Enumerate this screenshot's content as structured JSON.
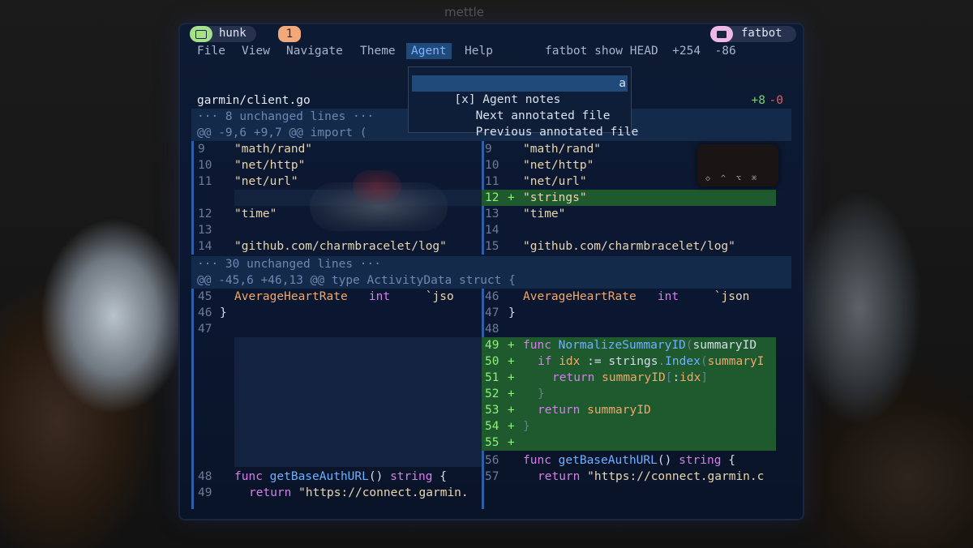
{
  "background": {
    "word": "mettle"
  },
  "tabs": {
    "hunk": {
      "label": "hunk",
      "icon": "terminal-icon"
    },
    "count": "1",
    "fatbot": {
      "label": "fatbot",
      "icon": "folder-icon"
    }
  },
  "menu": {
    "items": [
      "File",
      "View",
      "Navigate",
      "Theme",
      "Agent",
      "Help"
    ],
    "active": "Agent",
    "status": "fatbot show HEAD  +254  -86"
  },
  "dropdown": {
    "items": [
      {
        "label": "[x] Agent notes",
        "key": "a"
      },
      {
        "label": "   Next annotated file",
        "key": ""
      },
      {
        "label": "   Previous annotated file",
        "key": ""
      }
    ]
  },
  "file": {
    "name": "garmin/client.go",
    "add": "+8",
    "del": "-0"
  },
  "hunks": {
    "unchanged1": "··· 8 unchanged lines ···",
    "header1": "@@ -9,6 +9,7 @@ import (",
    "unchanged2": "··· 30 unchanged lines ···",
    "header2": "@@ -45,6 +46,13 @@ type ActivityData struct {"
  },
  "left": {
    "n9": "9",
    "c9": "\"math/rand\"",
    "n10": "10",
    "c10": "\"net/http\"",
    "n11": "11",
    "c11": "\"net/url\"",
    "n12": "12",
    "c12": "\"time\"",
    "n13": "13",
    "n14": "14",
    "c14": "\"github.com/charmbracelet/log\"",
    "n45": "45",
    "c45_field": "AverageHeartRate",
    "c45_type": "int",
    "c45_tag": "`jso",
    "n46": "46",
    "c46": "}",
    "n47": "47",
    "n48": "48",
    "c48_kw": "func",
    "c48_fn": "getBaseAuthURL",
    "c48_rest": "() ",
    "c48_ty": "string",
    "c48_end": " {",
    "n49": "49",
    "c49_kw": "return",
    "c49_s": "\"https://connect.garmin."
  },
  "right": {
    "n9": "9",
    "c9": "\"math/rand\"",
    "n10": "10",
    "c10": "\"net/http\"",
    "n11": "11",
    "c11": "\"net/url\"",
    "n12": "12",
    "m12": "+",
    "c12": "\"strings\"",
    "n13": "13",
    "c13": "\"time\"",
    "n14": "14",
    "n15": "15",
    "c15": "\"github.com/charmbracelet/log\"",
    "n46": "46",
    "c46_field": "AverageHeartRate",
    "c46_type": "int",
    "c46_tag": "`json",
    "n47": "47",
    "c47": "}",
    "n48": "48",
    "n49": "49",
    "m49": "+",
    "c49_kw": "func",
    "c49_fn": "NormalizeSummaryID",
    "c49_p": "(",
    "c49_id": "summaryID",
    "n50": "50",
    "m50": "+",
    "c50_kw": "if",
    "c50_id": "idx",
    "c50_op": " := ",
    "c50_pk": "strings",
    "c50_dot": ".",
    "c50_fn": "Index",
    "c50_p": "(",
    "c50_id2": "summaryI",
    "n51": "51",
    "m51": "+",
    "c51_kw": "return",
    "c51_id": "summaryID",
    "c51_b1": "[",
    "c51_pl": ":",
    "c51_id2": "idx",
    "c51_b2": "]",
    "n52": "52",
    "m52": "+",
    "c52": "}",
    "n53": "53",
    "m53": "+",
    "c53_kw": "return",
    "c53_id": "summaryID",
    "n54": "54",
    "m54": "+",
    "c54": "}",
    "n55": "55",
    "m55": "+",
    "n56": "56",
    "c56_kw": "func",
    "c56_fn": "getBaseAuthURL",
    "c56_rest": "() ",
    "c56_ty": "string",
    "c56_end": " {",
    "n57": "57",
    "c57_kw": "return",
    "c57_s": "\"https://connect.garmin.c"
  },
  "mini_window": {
    "keys": "◇^⌥⌘"
  }
}
